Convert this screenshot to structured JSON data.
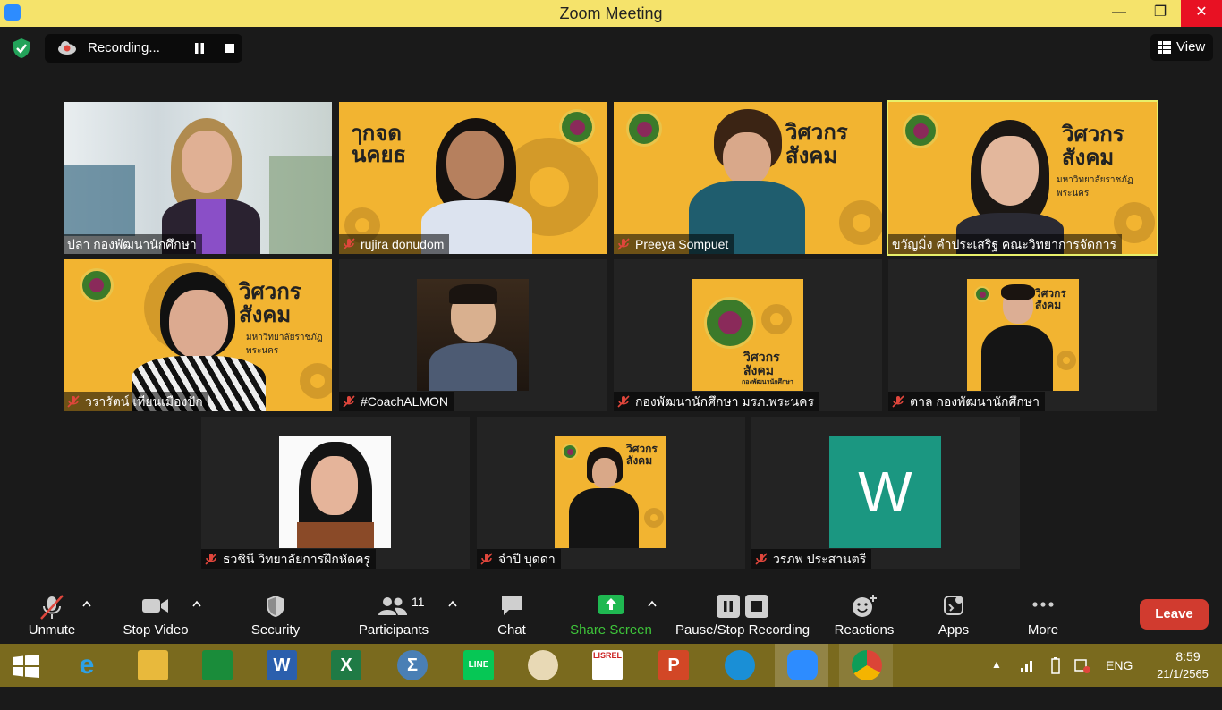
{
  "window": {
    "title": "Zoom Meeting"
  },
  "recording": {
    "status": "Recording..."
  },
  "view_button": {
    "label": "View"
  },
  "participants_tiles": [
    {
      "name": "ปลา  กองพัฒนานักศึกษา",
      "muted": false
    },
    {
      "name": "rujira donudom",
      "muted": true
    },
    {
      "name": "Preeya Sompuet",
      "muted": true
    },
    {
      "name": "ขวัญมิ่ง คำประเสริฐ คณะวิทยาการจัดการ",
      "muted": false,
      "active_speaker": true
    },
    {
      "name": "วรารัตน์ เทียนเมืองปัก",
      "muted": true
    },
    {
      "name": "#CoachALMON",
      "muted": true
    },
    {
      "name": "กองพัฒนานักศึกษา มรภ.พระนคร",
      "muted": true
    },
    {
      "name": "ตาล กองพัฒนานักศึกษา",
      "muted": true
    },
    {
      "name": "ธวชินี  วิทยาลัยการฝึกหัดครู",
      "muted": true
    },
    {
      "name": "จำปี บุดดา",
      "muted": true
    },
    {
      "name": "วรภพ ประสานตรี",
      "muted": true,
      "initial": "W"
    }
  ],
  "banner_text": {
    "line1": "วิศวกร",
    "line2": "สังคม",
    "university": "มหาวิทยาลัยราชภัฏพระนคร",
    "office": "กองพัฒนานักศึกษา"
  },
  "toolbar": {
    "unmute": "Unmute",
    "stop_video": "Stop Video",
    "security": "Security",
    "participants": "Participants",
    "participants_count": "11",
    "chat": "Chat",
    "share_screen": "Share Screen",
    "pause_stop_recording": "Pause/Stop Recording",
    "reactions": "Reactions",
    "apps": "Apps",
    "more": "More",
    "leave": "Leave"
  },
  "taskbar": {
    "language": "ENG",
    "time": "8:59",
    "date": "21/1/2565",
    "apps": [
      "ie-icon",
      "file-explorer-icon",
      "store-icon",
      "word-icon",
      "excel-icon",
      "calculator-icon",
      "line-icon",
      "paint-icon",
      "lisrel-icon",
      "powerpoint-icon",
      "edge-icon",
      "zoom-icon",
      "chrome-icon"
    ],
    "labels": {
      "word": "W",
      "excel": "X",
      "line": "LINE",
      "powerpoint": "P",
      "lisrel": "LISREL"
    }
  },
  "colors": {
    "titlebar": "#f5e36b",
    "meeting_bg": "#1a1a1a",
    "active_speaker_border": "#e8f06a",
    "share_green": "#3ec43a",
    "leave_red": "#d13b2f",
    "banner_yellow": "#f2b431"
  }
}
